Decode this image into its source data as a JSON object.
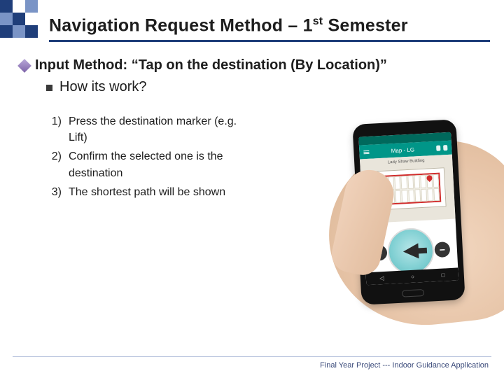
{
  "header": {
    "title_pre": "Navigation Request Method – 1",
    "title_sup": "st",
    "title_post": " Semester"
  },
  "section": {
    "heading": "Input Method: “Tap on the destination (By Location)”",
    "subheading": "How its work?"
  },
  "steps": [
    {
      "num": "1)",
      "text": "Press the destination marker (e.g. Lift)"
    },
    {
      "num": "2)",
      "text": "Confirm the selected one is the destination"
    },
    {
      "num": "3)",
      "text": "The shortest path will be shown"
    }
  ],
  "phone": {
    "appbar_title": "Map - LG",
    "building_label": "Lady Shaw Building",
    "plus": "+",
    "minus": "−",
    "nav_back": "◁",
    "nav_home": "○",
    "nav_recent": "□"
  },
  "footer": "Final Year Project --- Indoor Guidance Application"
}
